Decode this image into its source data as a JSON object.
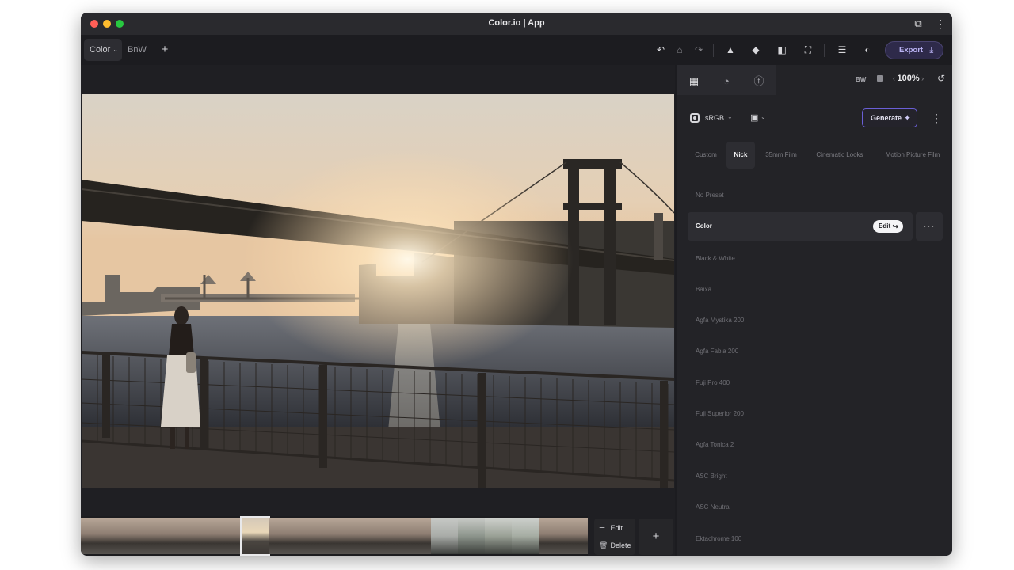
{
  "window": {
    "title": "Color.io | App"
  },
  "toolbar": {
    "tabs": [
      {
        "label": "Color",
        "active": true
      },
      {
        "label": "BnW",
        "active": false
      }
    ],
    "add_tab": "+",
    "export_label": "Export",
    "icons": [
      "undo-icon",
      "eraser-icon",
      "redo-icon",
      "histogram-icon",
      "cube-icon",
      "compare-icon",
      "fit-screen-icon",
      "menu-icon",
      "palette-icon"
    ]
  },
  "panel": {
    "tabs": [
      "adjust-icon",
      "curves-icon",
      "effects-icon"
    ],
    "bw_label": "BW",
    "zoom": "100%",
    "color_space": "sRGB",
    "generate_label": "Generate",
    "categories": [
      {
        "label": "Custom",
        "active": false
      },
      {
        "label": "Nick",
        "active": true
      },
      {
        "label": "35mm Film",
        "active": false
      },
      {
        "label": "Cinematic Looks",
        "active": false
      },
      {
        "label": "Motion Picture Film",
        "active": false
      }
    ],
    "presets": [
      {
        "label": "No Preset",
        "active": false
      },
      {
        "label": "Color",
        "active": true
      },
      {
        "label": "Black & White",
        "active": false
      },
      {
        "label": "Baixa",
        "active": false
      },
      {
        "label": "Agfa Mystika 200",
        "active": false
      },
      {
        "label": "Agfa Fabia 200",
        "active": false
      },
      {
        "label": "Fuji Pro 400",
        "active": false
      },
      {
        "label": "Fuji Superior 200",
        "active": false
      },
      {
        "label": "Agfa Tonica 2",
        "active": false
      },
      {
        "label": "ASC Bright",
        "active": false
      },
      {
        "label": "ASC Neutral",
        "active": false
      },
      {
        "label": "Ektachrome 100",
        "active": false
      }
    ],
    "edit_label": "Edit",
    "more_label": "···"
  },
  "filmstrip": {
    "thumb_count": 19,
    "selected_index": 6,
    "actions": [
      {
        "label": "Edit",
        "icon": "sliders-icon"
      },
      {
        "label": "Delete",
        "icon": "trash-icon"
      }
    ],
    "add_label": "+"
  },
  "colors": {
    "accent": "#7b6ff0",
    "window_bg": "#1c1c20",
    "panel_bg": "#232327"
  }
}
